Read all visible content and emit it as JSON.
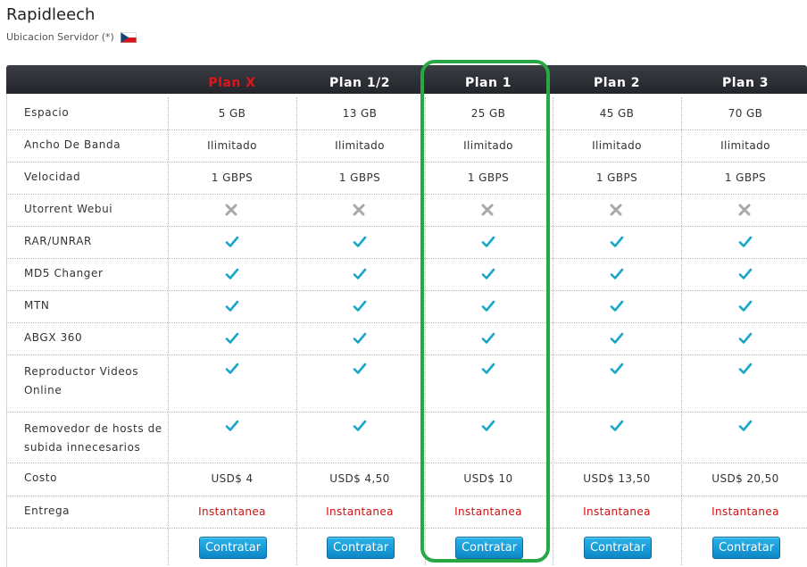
{
  "page": {
    "title": "Rapidleech",
    "subtitle": "Ubicacion Servidor (*)",
    "flag_icon": "czech-flag-icon"
  },
  "plans": [
    {
      "name": "Plan X",
      "header_color": "#e0141a"
    },
    {
      "name": "Plan 1/2",
      "header_color": "#ffffff"
    },
    {
      "name": "Plan 1",
      "header_color": "#ffffff"
    },
    {
      "name": "Plan 2",
      "header_color": "#ffffff"
    },
    {
      "name": "Plan 3",
      "header_color": "#ffffff"
    }
  ],
  "features": [
    {
      "label": "Espacio",
      "values": [
        "5 GB",
        "13 GB",
        "25 GB",
        "45 GB",
        "70 GB"
      ]
    },
    {
      "label": "Ancho De Banda",
      "values": [
        "Ilimitado",
        "Ilimitado",
        "Ilimitado",
        "Ilimitado",
        "Ilimitado"
      ]
    },
    {
      "label": "Velocidad",
      "values": [
        "1 GBPS",
        "1 GBPS",
        "1 GBPS",
        "1 GBPS",
        "1 GBPS"
      ]
    },
    {
      "label": "Utorrent Webui",
      "values": [
        "cross-icon",
        "cross-icon",
        "cross-icon",
        "cross-icon",
        "cross-icon"
      ]
    },
    {
      "label": "RAR/UNRAR",
      "values": [
        "check-icon",
        "check-icon",
        "check-icon",
        "check-icon",
        "check-icon"
      ]
    },
    {
      "label": "MD5 Changer",
      "values": [
        "check-icon",
        "check-icon",
        "check-icon",
        "check-icon",
        "check-icon"
      ]
    },
    {
      "label": "MTN",
      "values": [
        "check-icon",
        "check-icon",
        "check-icon",
        "check-icon",
        "check-icon"
      ]
    },
    {
      "label": "ABGX 360",
      "values": [
        "check-icon",
        "check-icon",
        "check-icon",
        "check-icon",
        "check-icon"
      ]
    },
    {
      "label": "Reproductor Videos Online",
      "label_lines": [
        "Reproductor Videos",
        "Online"
      ],
      "values": [
        "check-icon",
        "check-icon",
        "check-icon",
        "check-icon",
        "check-icon"
      ]
    },
    {
      "label": "Removedor de hosts de subida innecesarios",
      "label_lines": [
        "Removedor de hosts de",
        "subida innecesarios"
      ],
      "values": [
        "check-icon",
        "check-icon",
        "check-icon",
        "check-icon",
        "check-icon"
      ]
    },
    {
      "label": "Costo",
      "values": [
        "USD$ 4",
        "USD$ 4,50",
        "USD$ 10",
        "USD$ 13,50",
        "USD$ 20,50"
      ]
    },
    {
      "label": "Entrega",
      "values": [
        "Instantanea",
        "Instantanea",
        "Instantanea",
        "Instantanea",
        "Instantanea"
      ],
      "color": "#cc1111"
    }
  ],
  "button_label": "Contratar",
  "highlighted_plan": "Plan 1",
  "colors": {
    "header_bg": "#2b2d33",
    "accent_red": "#e0141a",
    "check": "#1aa6c9",
    "cross": "#a8a8a8",
    "highlight": "#28a745",
    "button": "#1a9ad8"
  }
}
